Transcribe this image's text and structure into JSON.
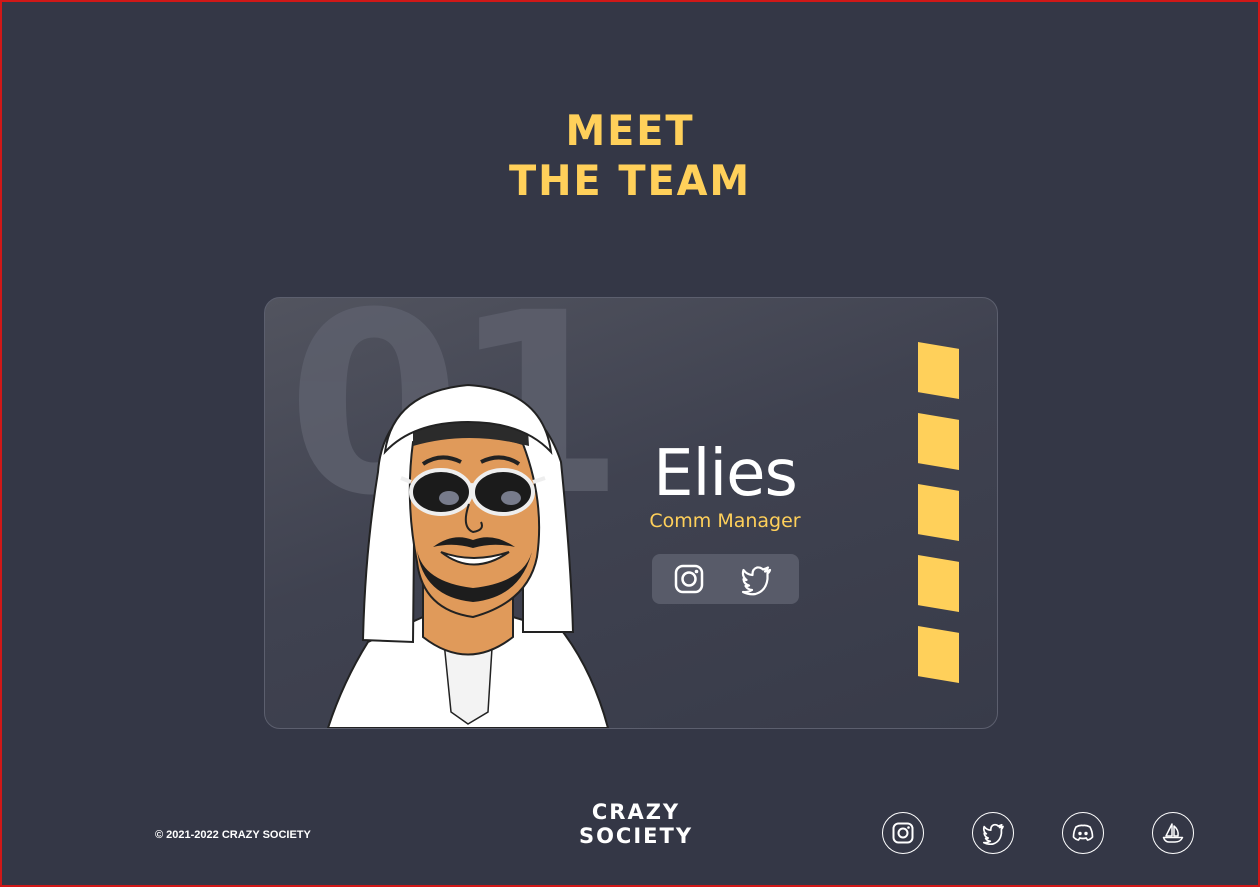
{
  "page": {
    "title_line1": "MEET",
    "title_line2": "THE TEAM"
  },
  "card": {
    "number": "01",
    "name": "Elies",
    "role": "Comm Manager",
    "socials": [
      {
        "icon": "instagram-icon"
      },
      {
        "icon": "twitter-icon"
      }
    ],
    "stripe_count": 5
  },
  "footer": {
    "copyright": "© 2021-2022 CRAZY SOCIETY",
    "logo_line1": "CRAZY",
    "logo_line2": "SOCIETY",
    "socials": [
      {
        "icon": "instagram-icon"
      },
      {
        "icon": "twitter-icon"
      },
      {
        "icon": "discord-icon"
      },
      {
        "icon": "opensea-icon"
      }
    ]
  },
  "colors": {
    "background": "#343746",
    "accent": "#ffd05a",
    "text": "#ffffff"
  }
}
